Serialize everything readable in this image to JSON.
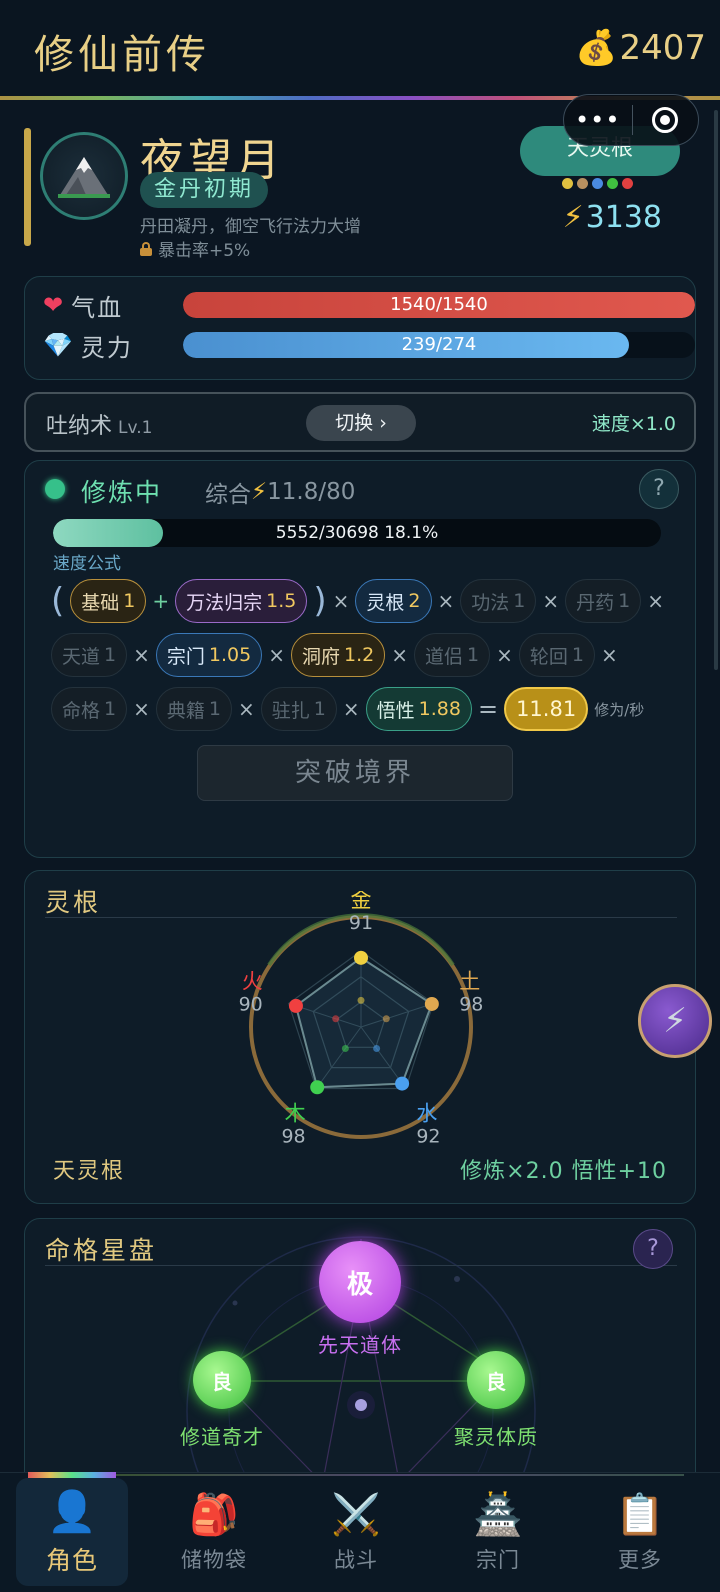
{
  "header": {
    "title": "修仙前传",
    "gold": "2407",
    "gold_icon": "money-bag-icon"
  },
  "capsule": {
    "more": "•••"
  },
  "profile": {
    "name": "夜望月",
    "realm": "金丹初期",
    "realm_desc": "丹田凝丹，御空飞行法力大增",
    "bonus": "暴击率+5%",
    "root_badge": "天灵根",
    "root_colors": [
      "#e0c040",
      "#b89060",
      "#4a8ae0",
      "#40c040",
      "#e04040"
    ],
    "power": "3138"
  },
  "stats": {
    "hp_label": "气血",
    "hp_text": "1540/1540",
    "hp_fraction": 1.0,
    "mp_label": "灵力",
    "mp_text": "239/274",
    "mp_fraction": 0.872
  },
  "breathing": {
    "name": "吐纳术",
    "level": "Lv.1",
    "switch_label": "切换 ›",
    "speed": "速度×1.0"
  },
  "cultivation": {
    "status": "修炼中",
    "total_label": "综合",
    "total_value": "11.8/80",
    "help": "?",
    "exp_text": "5552/30698  18.1%",
    "exp_fraction": 0.181,
    "formula_label": "速度公式",
    "factors": {
      "base": {
        "label": "基础",
        "value": "1"
      },
      "method": {
        "label": "万法归宗",
        "value": "1.5"
      },
      "root": {
        "label": "灵根",
        "value": "2"
      },
      "skill": {
        "label": "功法",
        "value": "1"
      },
      "pill": {
        "label": "丹药",
        "value": "1"
      },
      "heaven": {
        "label": "天道",
        "value": "1"
      },
      "sect": {
        "label": "宗门",
        "value": "1.05"
      },
      "cave": {
        "label": "洞府",
        "value": "1.2"
      },
      "partner": {
        "label": "道侣",
        "value": "1"
      },
      "cycle": {
        "label": "轮回",
        "value": "1"
      },
      "fate": {
        "label": "命格",
        "value": "1"
      },
      "books": {
        "label": "典籍",
        "value": "1"
      },
      "station": {
        "label": "驻扎",
        "value": "1"
      },
      "insight": {
        "label": "悟性",
        "value": "1.88"
      }
    },
    "result": "11.81",
    "result_unit": "修为/秒",
    "breakthrough": "突破境界"
  },
  "spirit_root": {
    "title": "灵根",
    "elements": [
      {
        "name": "金",
        "value": 91,
        "color": "#f0d040"
      },
      {
        "name": "土",
        "value": 98,
        "color": "#e0a850"
      },
      {
        "name": "水",
        "value": 92,
        "color": "#4aa0f0"
      },
      {
        "name": "木",
        "value": 98,
        "color": "#40d050"
      },
      {
        "name": "火",
        "value": 90,
        "color": "#f04040"
      }
    ],
    "root_name": "天灵根",
    "bonus": "修炼×2.0  悟性+10"
  },
  "fate": {
    "title": "命格星盘",
    "help": "?",
    "top": {
      "grade": "极",
      "name": "先天道体"
    },
    "left": {
      "grade": "良",
      "name": "修道奇才"
    },
    "right": {
      "grade": "良",
      "name": "聚灵体质"
    }
  },
  "nav": [
    {
      "label": "角色",
      "icon": "👤"
    },
    {
      "label": "储物袋",
      "icon": "🎒"
    },
    {
      "label": "战斗",
      "icon": "⚔️"
    },
    {
      "label": "宗门",
      "icon": "🏯"
    },
    {
      "label": "更多",
      "icon": "📋"
    }
  ],
  "fab_icon": "⚡"
}
